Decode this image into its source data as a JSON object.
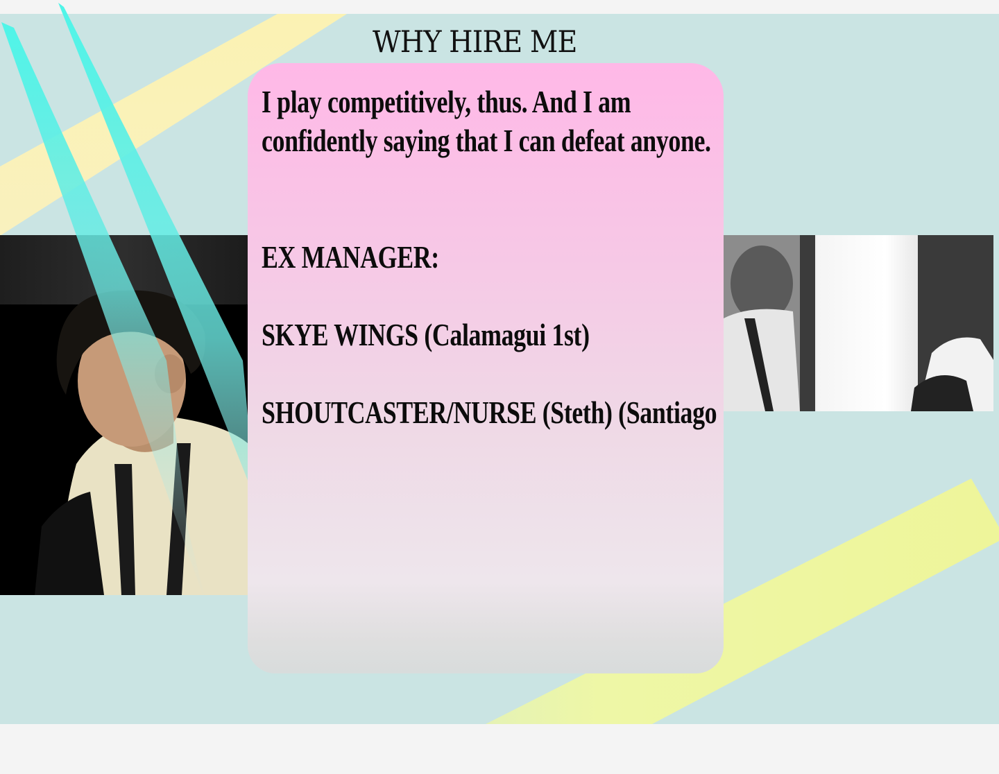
{
  "section": {
    "title": "WHY HIRE ME"
  },
  "card": {
    "intro": "I play competitively, thus. And I am confidently saying that I can defeat anyone.",
    "role_heading": "EX MANAGER:",
    "team": "SKYE WINGS (Calamagui 1st)",
    "roles": "SHOUTCASTER/NURSE (Steth)   (Santiago City)"
  },
  "colors": {
    "page_bg": "#f4f4f4",
    "panel_bg": "#cae4e3",
    "card_top": "#ffb8e7",
    "card_bottom": "#eee6ec",
    "cyan_accent": "#4ff5e8",
    "yellow_accent": "#eef59a"
  },
  "images": {
    "left_photo": "portrait-photo",
    "right_photo": "group-photo-bw"
  }
}
